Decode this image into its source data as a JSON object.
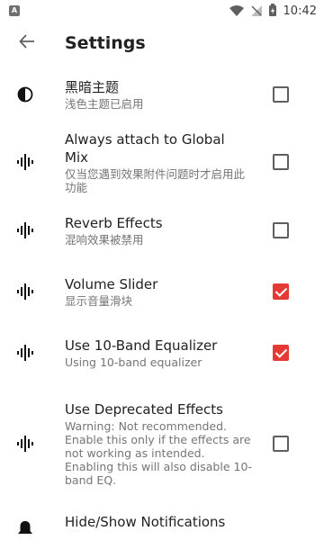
{
  "status_bar": {
    "app_icon": "A",
    "time": "10:42",
    "icons": [
      "wifi-icon",
      "signal-icon",
      "battery-icon"
    ]
  },
  "app_bar": {
    "title": "Settings",
    "back_icon": "arrow-back-icon"
  },
  "preferences": [
    {
      "icon": "contrast-icon",
      "title": "黑暗主题",
      "summary": "浅色主题已启用",
      "checked": false
    },
    {
      "icon": "waveform-icon",
      "title": "Always attach to Global Mix",
      "summary": "仅当您遇到效果附件问题时才启用此功能",
      "checked": false
    },
    {
      "icon": "waveform-icon",
      "title": "Reverb Effects",
      "summary": "混响效果被禁用",
      "checked": false
    },
    {
      "icon": "waveform-icon",
      "title": "Volume Slider",
      "summary": "显示音量滑块",
      "checked": true
    },
    {
      "icon": "waveform-icon",
      "title": "Use 10-Band Equalizer",
      "summary": "Using 10-band equalizer",
      "checked": true
    },
    {
      "icon": "waveform-icon",
      "title": "Use Deprecated Effects",
      "summary": "Warning: Not recommended. Enable this only if the effects are not working as intended. Enabling this will also disable 10-band EQ.",
      "checked": false
    },
    {
      "icon": "bell-icon",
      "title": "Hide/Show Notifications",
      "summary": "",
      "checked": null
    }
  ],
  "colors": {
    "accent": "#e53935"
  }
}
